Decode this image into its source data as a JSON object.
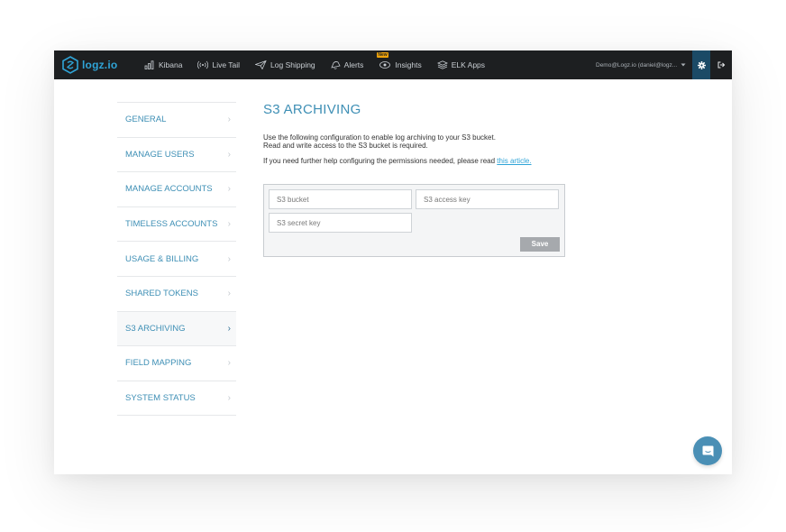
{
  "header": {
    "logo_text": "logz.io",
    "nav": [
      {
        "label": "Kibana",
        "icon": "bar-chart-icon"
      },
      {
        "label": "Live Tail",
        "icon": "broadcast-icon"
      },
      {
        "label": "Log Shipping",
        "icon": "paper-plane-icon"
      },
      {
        "label": "Alerts",
        "icon": "bell-icon"
      },
      {
        "label": "Insights",
        "icon": "insights-icon",
        "badge": "New"
      },
      {
        "label": "ELK Apps",
        "icon": "layers-icon"
      }
    ],
    "account_label": "Demo@Logz.io (daniel@logz...",
    "colors": {
      "bar": "#1d1f21",
      "active_icon_bg": "#1b4a66",
      "accent": "#2fa4d7"
    }
  },
  "sidebar": {
    "items": [
      {
        "label": "GENERAL"
      },
      {
        "label": "MANAGE USERS"
      },
      {
        "label": "MANAGE ACCOUNTS"
      },
      {
        "label": "TIMELESS ACCOUNTS"
      },
      {
        "label": "USAGE & BILLING"
      },
      {
        "label": "SHARED TOKENS"
      },
      {
        "label": "S3 ARCHIVING",
        "active": true
      },
      {
        "label": "FIELD MAPPING"
      },
      {
        "label": "SYSTEM STATUS"
      }
    ]
  },
  "main": {
    "title": "S3 ARCHIVING",
    "desc_line1": "Use the following configuration to enable log archiving to your S3 bucket.",
    "desc_line2": "Read and write access to the S3 bucket is required.",
    "help_text": "If you need further help configuring the permissions needed, please read ",
    "help_link": "this article.",
    "form": {
      "bucket_placeholder": "S3 bucket",
      "bucket_value": "",
      "access_key_placeholder": "S3 access key",
      "access_key_value": "",
      "secret_key_placeholder": "S3 secret key",
      "secret_key_value": "",
      "save_label": "Save"
    }
  },
  "chat": {
    "icon": "chat-bubble-icon"
  }
}
